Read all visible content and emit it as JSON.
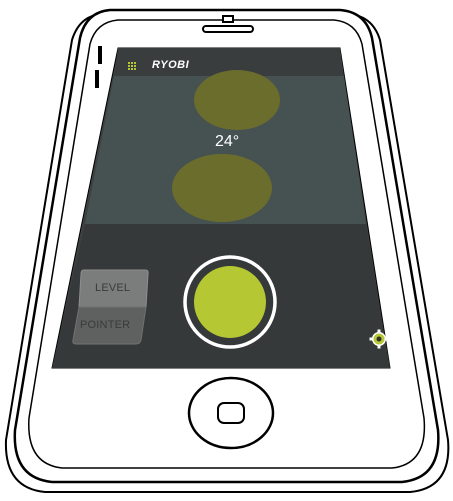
{
  "app": {
    "brand": "RYOBI",
    "menu_icon": "grid-menu-icon",
    "accent_color": "#b5c733"
  },
  "level": {
    "angle_reading": "24°",
    "bubble_color": "#6b6d2c"
  },
  "controls": {
    "mode_options": [
      "LEVEL",
      "POINTER"
    ],
    "selected_mode": "LEVEL",
    "shutter_color": "#b5c733",
    "settings_icon": "gear-icon"
  },
  "device": {
    "home_button_icon": "home-button-icon"
  }
}
